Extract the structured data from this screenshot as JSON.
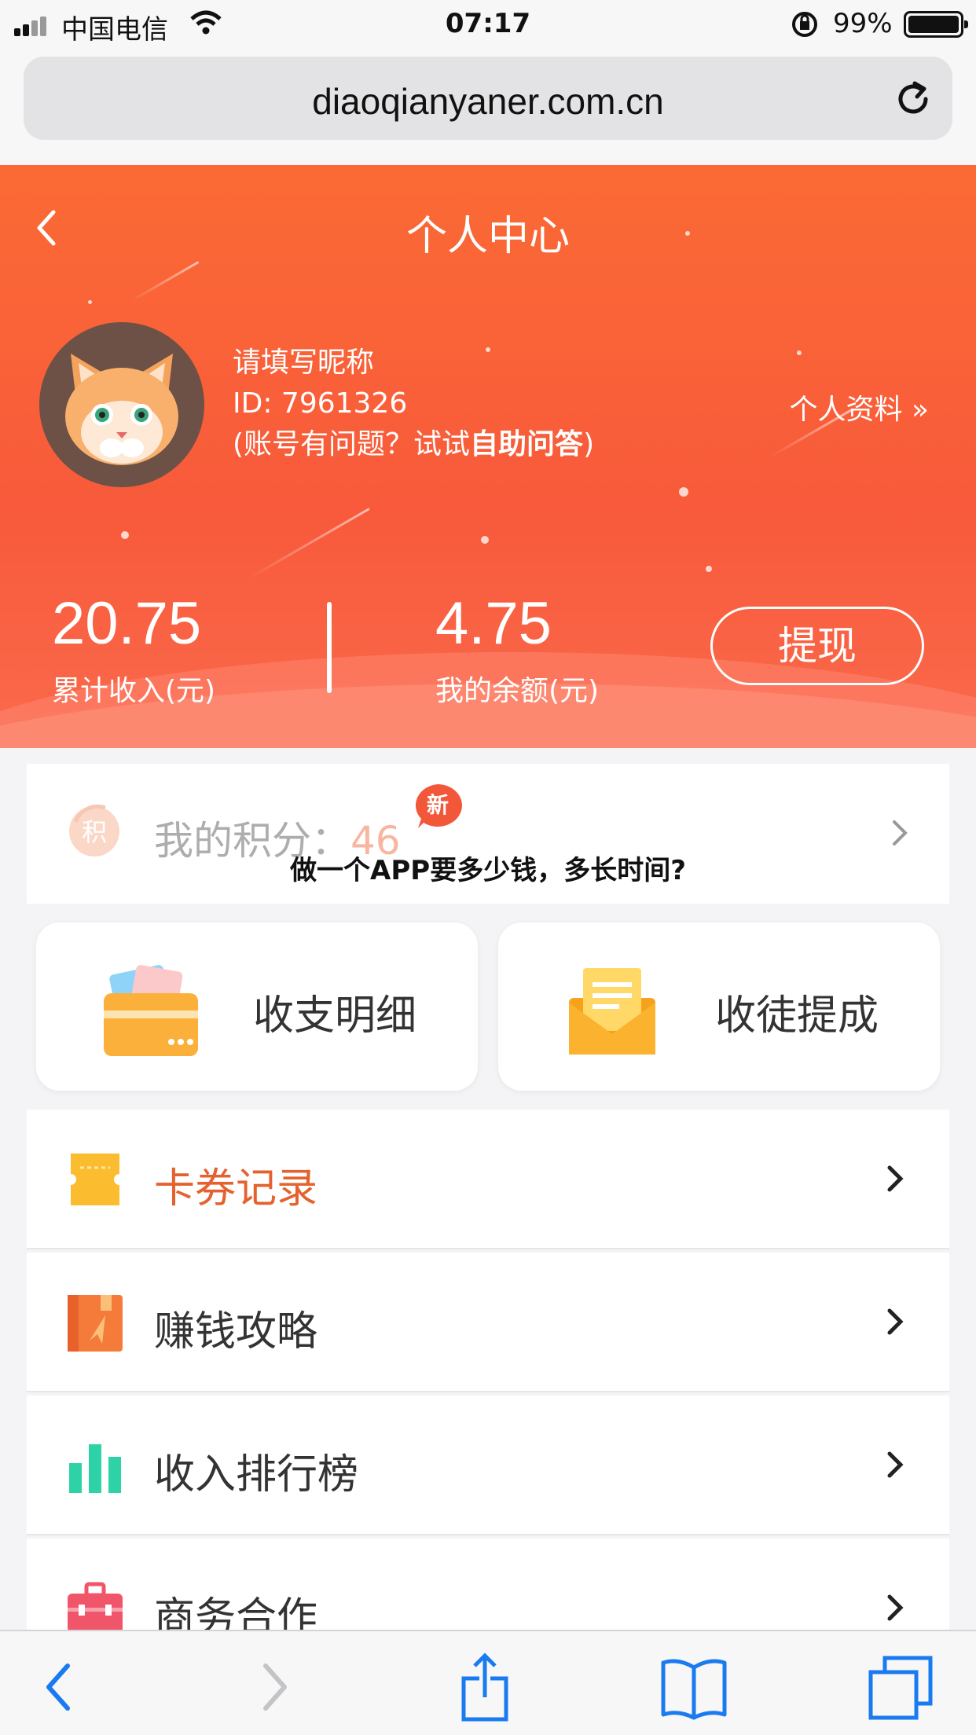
{
  "status_bar": {
    "carrier": "中国电信",
    "time": "07:17",
    "battery_percent": "99%"
  },
  "browser": {
    "url": "diaoqianyaner.com.cn"
  },
  "header": {
    "title": "个人中心",
    "nickname": "请填写昵称",
    "id_text": "ID: 7961326",
    "help_prefix": "(账号有问题？试试",
    "help_link": "自助问答",
    "help_suffix": ")",
    "profile_link": "个人资料 »"
  },
  "stats": {
    "total_income_value": "20.75",
    "total_income_label": "累计收入(元)",
    "balance_value": "4.75",
    "balance_label": "我的余额(元)",
    "withdraw_label": "提现"
  },
  "points": {
    "icon_char": "积",
    "label": "我的积分：",
    "value": "46",
    "badge": "新"
  },
  "overlay_caption": "做一个APP要多少钱，多长时间?",
  "cards": [
    {
      "label": "收支明细",
      "icon": "wallet-icon"
    },
    {
      "label": "收徒提成",
      "icon": "envelope-icon"
    }
  ],
  "menu": [
    {
      "label": "卡券记录",
      "icon": "ticket-icon"
    },
    {
      "label": "赚钱攻略",
      "icon": "guide-book-icon"
    },
    {
      "label": "收入排行榜",
      "icon": "bar-chart-icon"
    },
    {
      "label": "商务合作",
      "icon": "briefcase-icon"
    }
  ],
  "colors": {
    "header_orange": "#fb6a35",
    "accent_text": "#e4622e",
    "ios_blue": "#1a7bf0"
  }
}
